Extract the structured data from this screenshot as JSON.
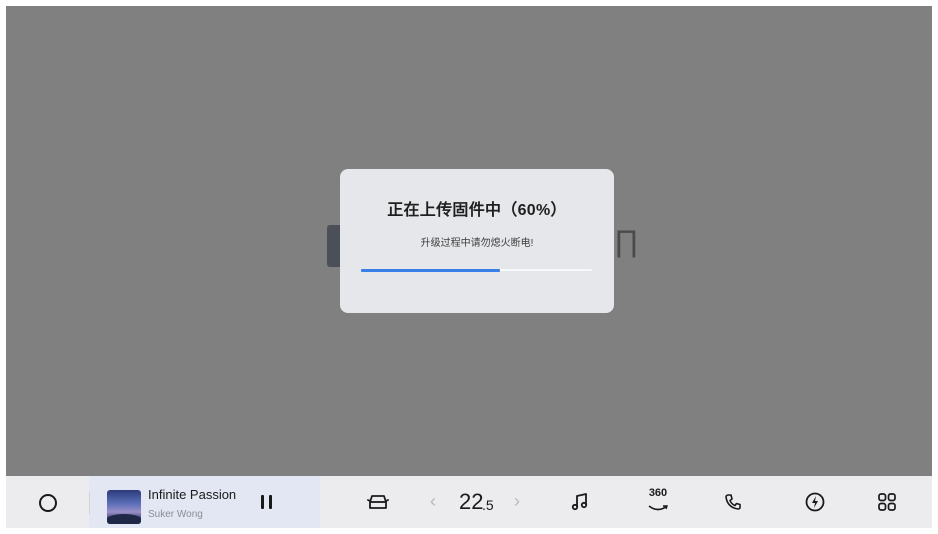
{
  "dialog": {
    "title": "正在上传固件中（60%）",
    "message": "升级过程中请勿熄火断电!",
    "progress_percent": 60,
    "progress_color": "#3a7ee8"
  },
  "taskbar": {
    "home_icon": "circle-home-icon",
    "media": {
      "song_title": "Infinite Passion",
      "artist": "Suker Wong",
      "play_state_icon": "pause-icon"
    },
    "car_icon": "car-icon",
    "climate": {
      "temperature_int": "22",
      "temperature_dec": ".5",
      "decrease_icon": "chevron-left-icon",
      "increase_icon": "chevron-right-icon"
    },
    "music_icon": "music-note-icon",
    "camera360_label": "360",
    "phone_icon": "phone-icon",
    "charging_icon": "lightning-icon",
    "apps_icon": "apps-grid-icon"
  },
  "colors": {
    "overlay": "#808080",
    "dialog_bg": "#e6e7eb",
    "taskbar_bg": "#ececef",
    "media_panel_bg": "#e2e7f3"
  }
}
